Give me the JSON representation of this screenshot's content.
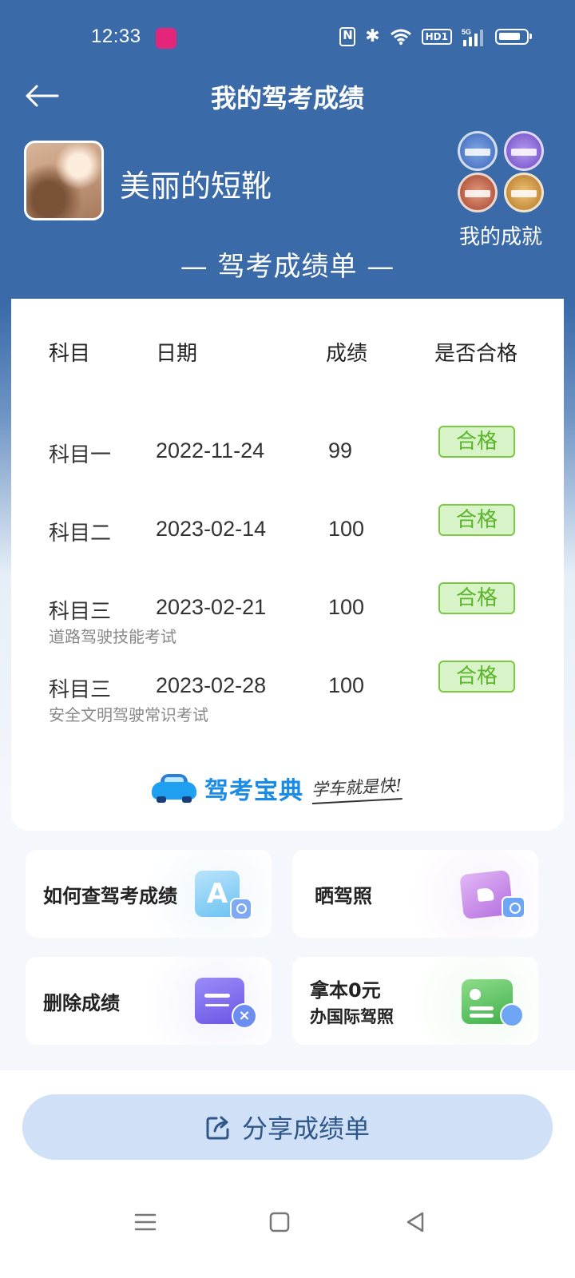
{
  "status_bar": {
    "time": "12:33",
    "icons": [
      "nfc-icon",
      "bluetooth-icon",
      "wifi-icon",
      "hd-icon",
      "signal-5g-icon",
      "battery-icon"
    ],
    "hd_label": "HD1"
  },
  "header": {
    "title": "我的驾考成绩",
    "back_icon": "arrow-left-icon"
  },
  "profile": {
    "username": "美丽的短靴",
    "achievements_label": "我的成就"
  },
  "section_title": "— 驾考成绩单 —",
  "table": {
    "headers": [
      "科目",
      "日期",
      "成绩",
      "是否合格"
    ],
    "rows": [
      {
        "subject": "科目一",
        "subtitle": "",
        "date": "2022-11-24",
        "score": "99",
        "status": "合格"
      },
      {
        "subject": "科目二",
        "subtitle": "",
        "date": "2023-02-14",
        "score": "100",
        "status": "合格"
      },
      {
        "subject": "科目三",
        "subtitle": "道路驾驶技能考试",
        "date": "2023-02-21",
        "score": "100",
        "status": "合格"
      },
      {
        "subject": "科目三",
        "subtitle": "安全文明驾驶常识考试",
        "date": "2023-02-28",
        "score": "100",
        "status": "合格"
      }
    ]
  },
  "brand": {
    "name": "驾考宝典",
    "slogan": "学车就是快!"
  },
  "actions": [
    {
      "label": "如何查驾考成绩",
      "label_line2": "",
      "icon": "search-doc-icon"
    },
    {
      "label": "晒驾照",
      "label_line2": "",
      "icon": "photo-share-icon"
    },
    {
      "label": "删除成绩",
      "label_line2": "",
      "icon": "delete-record-icon"
    },
    {
      "label": "拿本0元",
      "label_line2": "办国际驾照",
      "icon": "license-card-icon"
    }
  ],
  "share_button": {
    "label": "分享成绩单",
    "icon": "share-icon"
  },
  "nav_bar": {
    "icons": [
      "menu-icon",
      "home-icon",
      "back-triangle-icon"
    ]
  },
  "colors": {
    "header_bg": "#3a6aa8",
    "pass_bg": "#d9f3c8",
    "pass_border": "#7ac943",
    "pass_text": "#5bb52b",
    "share_bg": "#cfe0f7",
    "share_text": "#2f5788",
    "brand_blue": "#1a8be6"
  }
}
